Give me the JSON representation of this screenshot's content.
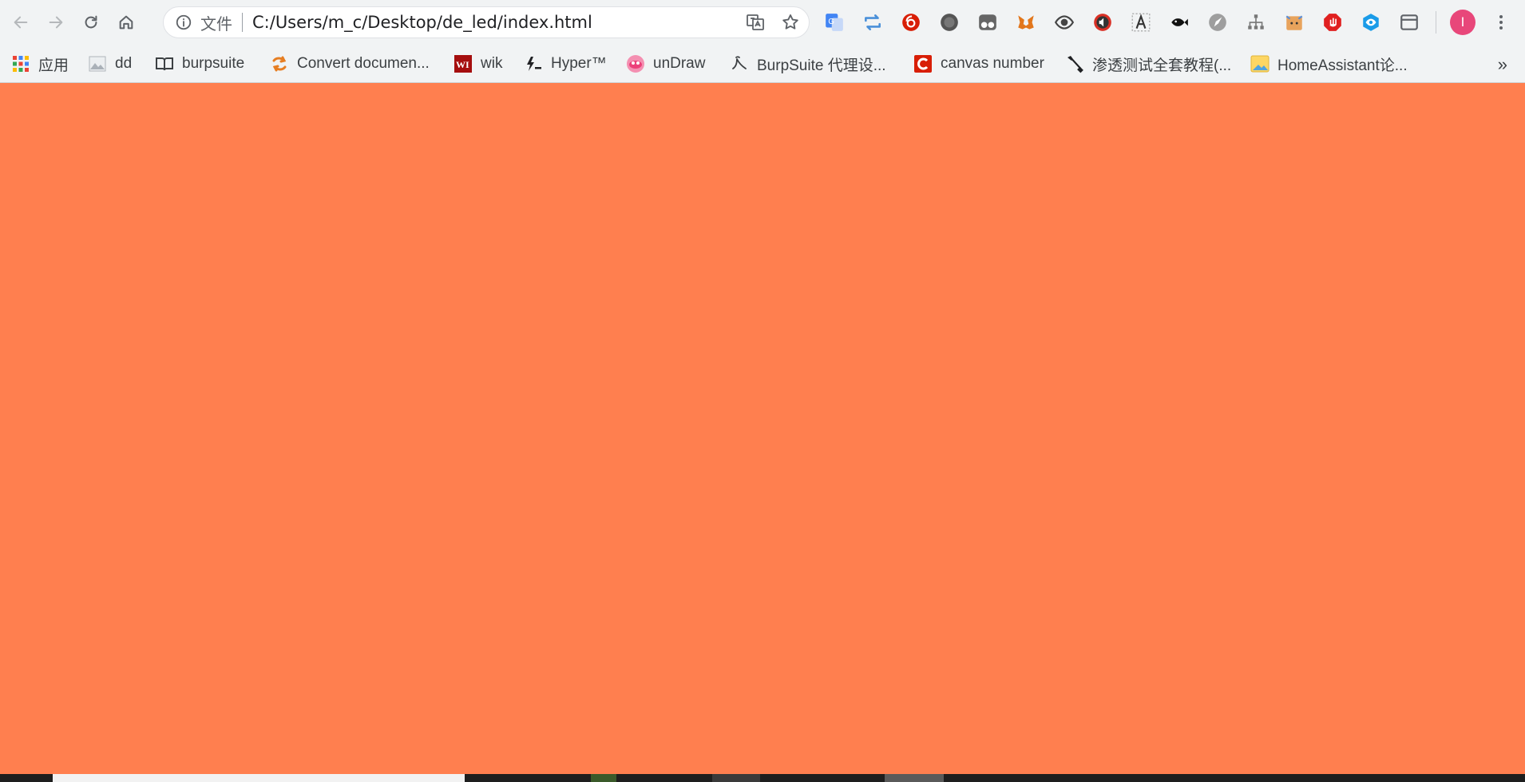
{
  "toolbar": {
    "back_label": "Back",
    "forward_label": "Forward",
    "reload_label": "Reload",
    "home_label": "Home",
    "security_icon": "info-icon",
    "scheme_label": "文件",
    "url": "C:/Users/m_c/Desktop/de_led/index.html",
    "profile_initial": "I"
  },
  "extensions": [
    {
      "name": "google-translate-ext-icon",
      "color": "#4285f4"
    },
    {
      "name": "repost-ext-icon",
      "color": "#4a90d9"
    },
    {
      "name": "netease-ext-icon",
      "color": "#d81e06"
    },
    {
      "name": "dark-circle-ext-icon",
      "color": "#555555"
    },
    {
      "name": "tampermonkey-ext-icon",
      "color": "#666666"
    },
    {
      "name": "metamask-ext-icon",
      "color": "#e2761b"
    },
    {
      "name": "eye-ext-icon",
      "color": "#444444"
    },
    {
      "name": "audio-ext-icon",
      "color": "#d93025"
    },
    {
      "name": "font-ext-icon",
      "color": "#333333"
    },
    {
      "name": "fish-ext-icon",
      "color": "#111111"
    },
    {
      "name": "pen-ext-icon",
      "color": "#9e9e9e"
    },
    {
      "name": "tree-ext-icon",
      "color": "#777777"
    },
    {
      "name": "cat-ext-icon",
      "color": "#e8a35c"
    },
    {
      "name": "adblock-ext-icon",
      "color": "#e02020"
    },
    {
      "name": "eye-blue-ext-icon",
      "color": "#1a9be8"
    },
    {
      "name": "window-ext-icon",
      "color": "#5f6368"
    }
  ],
  "bookmarks": [
    {
      "label": "应用",
      "icon": "apps-grid-icon"
    },
    {
      "label": "dd",
      "icon": "image-icon"
    },
    {
      "label": "burpsuite",
      "icon": "book-icon"
    },
    {
      "label": "Convert documen...",
      "icon": "convert-icon"
    },
    {
      "label": "wik",
      "icon": "wiki-icon"
    },
    {
      "label": "Hyper™",
      "icon": "hyper-icon"
    },
    {
      "label": "unDraw",
      "icon": "undraw-icon"
    },
    {
      "label": "BurpSuite 代理设...",
      "icon": "burp-icon"
    },
    {
      "label": "canvas number",
      "icon": "csdn-icon"
    },
    {
      "label": "渗透测试全套教程(...",
      "icon": "tool-icon"
    },
    {
      "label": "HomeAssistant论...",
      "icon": "folder-icon"
    }
  ],
  "bookmarks_more": "»",
  "colors": {
    "page_background": "#ff7f4f",
    "chrome_background": "#f1f3f4",
    "avatar": "#e8477a"
  }
}
